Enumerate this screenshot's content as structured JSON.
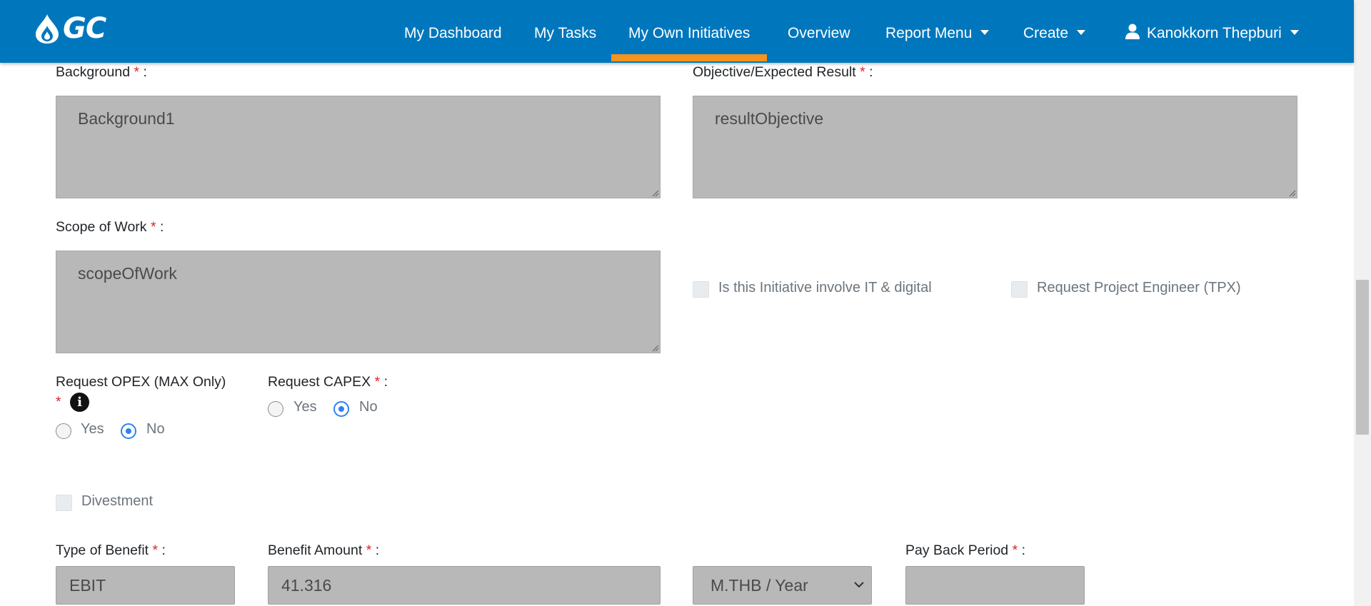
{
  "navbar": {
    "logo_text": "GC",
    "items": [
      {
        "label": "My Dashboard"
      },
      {
        "label": "My Tasks"
      },
      {
        "label": "My Own Initiatives"
      },
      {
        "label": "Overview"
      },
      {
        "label": "Report Menu"
      },
      {
        "label": "Create"
      }
    ],
    "user_name": "Kanokkorn Thepburi",
    "active_tab": "My Own Initiatives",
    "accent_color": "#f7941d",
    "bar_color": "#0077bd"
  },
  "form": {
    "background": {
      "label": "Background",
      "value": "Background1"
    },
    "objective": {
      "label": "Objective/Expected Result",
      "value": "resultObjective"
    },
    "scope": {
      "label": "Scope of Work",
      "value": "scopeOfWork"
    },
    "it_digital": {
      "label": "Is this Initiative involve IT & digital",
      "checked": false
    },
    "tpx": {
      "label": "Request Project Engineer (TPX)",
      "checked": false
    },
    "opex": {
      "label": "Request OPEX (MAX Only)",
      "yes": "Yes",
      "no": "No",
      "selected": "No"
    },
    "capex": {
      "label": "Request CAPEX",
      "yes": "Yes",
      "no": "No",
      "selected": "No"
    },
    "divestment": {
      "label": "Divestment",
      "checked": false
    },
    "type_of_benefit": {
      "label": "Type of Benefit",
      "value": "EBIT"
    },
    "benefit_amount": {
      "label": "Benefit Amount",
      "value": "41.316"
    },
    "unit": {
      "value": "M.THB / Year"
    },
    "payback": {
      "label": "Pay Back Period",
      "value": ""
    },
    "required_mark": "*",
    "colon": ":"
  }
}
